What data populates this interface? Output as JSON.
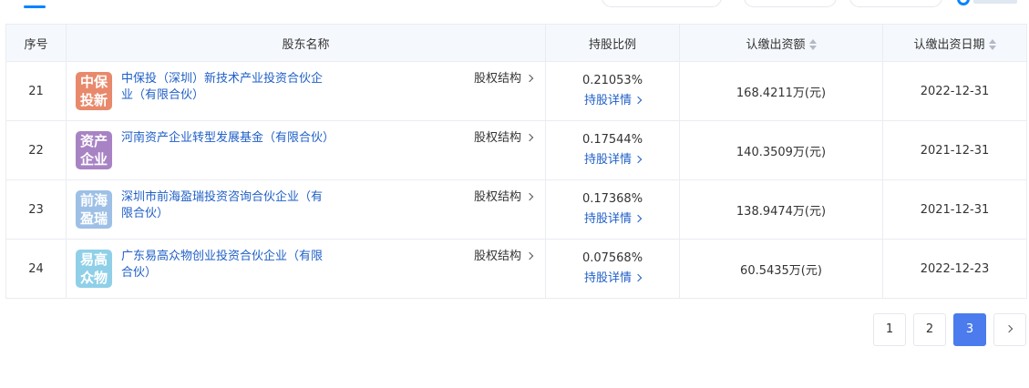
{
  "table": {
    "headers": {
      "seq": "序号",
      "name": "股东名称",
      "ratio": "持股比例",
      "amount": "认缴出资额",
      "date": "认缴出资日期"
    },
    "rows": [
      {
        "seq": "21",
        "avatar_line1": "中保",
        "avatar_line2": "投新",
        "avatar_color": "#e8896b",
        "name": "中保投（深圳）新技术产业投资合伙企业（有限合伙）",
        "structure_label": "股权结构",
        "ratio": "0.21053%",
        "detail_label": "持股详情",
        "amount": "168.4211万(元)",
        "date": "2022-12-31"
      },
      {
        "seq": "22",
        "avatar_line1": "资产",
        "avatar_line2": "企业",
        "avatar_color": "#a883c4",
        "name": "河南资产企业转型发展基金（有限合伙）",
        "structure_label": "股权结构",
        "ratio": "0.17544%",
        "detail_label": "持股详情",
        "amount": "140.3509万(元)",
        "date": "2021-12-31"
      },
      {
        "seq": "23",
        "avatar_line1": "前海",
        "avatar_line2": "盈瑞",
        "avatar_color": "#9ec0e6",
        "name": "深圳市前海盈瑞投资咨询合伙企业（有限合伙）",
        "structure_label": "股权结构",
        "ratio": "0.17368%",
        "detail_label": "持股详情",
        "amount": "138.9474万(元)",
        "date": "2021-12-31"
      },
      {
        "seq": "24",
        "avatar_line1": "易高",
        "avatar_line2": "众物",
        "avatar_color": "#8fd0e8",
        "name": "广东易高众物创业投资合伙企业（有限合伙）",
        "structure_label": "股权结构",
        "ratio": "0.07568%",
        "detail_label": "持股详情",
        "amount": "60.5435万(元)",
        "date": "2022-12-23"
      }
    ]
  },
  "pagination": {
    "pages": [
      "1",
      "2",
      "3"
    ],
    "current": "3"
  },
  "colors": {
    "link": "#1f5fc7",
    "active_page": "#4b7bec",
    "header_bg": "#f5f8fc",
    "border": "#e9ecf1"
  }
}
